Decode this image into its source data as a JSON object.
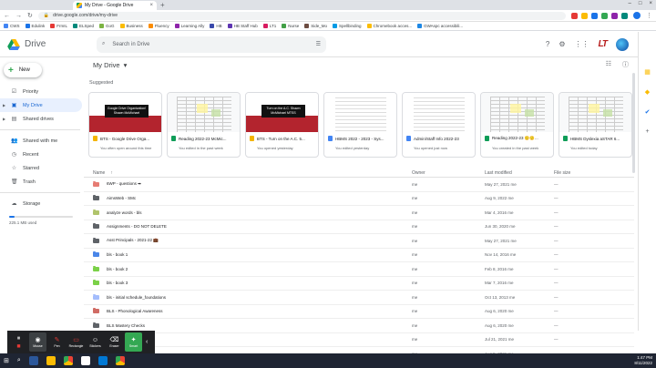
{
  "browser": {
    "tab_title": "My Drive - Google Drive",
    "url": "drive.google.com/drive/my-drive",
    "bookmarks": [
      "CWS",
      "Edulink",
      "FrmIL",
      "ELSped",
      "GoG",
      "Business",
      "Fluency",
      "Learning Ally",
      "HB",
      "HB Staff Hub",
      "LT1",
      "Nurse",
      "Side_Mo",
      "Spellbinding",
      "Chromebook acces...",
      "GWAspc accessibili..."
    ]
  },
  "drive": {
    "app_name": "Drive",
    "search_placeholder": "Search in Drive",
    "new_label": "New",
    "nav": [
      {
        "label": "Priority",
        "icon": "priority-icon"
      },
      {
        "label": "My Drive",
        "icon": "my-drive-icon"
      },
      {
        "label": "Shared drives",
        "icon": "shared-drives-icon"
      },
      {
        "label": "Shared with me",
        "icon": "shared-with-me-icon"
      },
      {
        "label": "Recent",
        "icon": "clock-icon"
      },
      {
        "label": "Starred",
        "icon": "star-icon"
      },
      {
        "label": "Trash",
        "icon": "trash-icon"
      },
      {
        "label": "Storage",
        "icon": "cloud-icon"
      }
    ],
    "storage_used": "225.1 MB used",
    "storage_fraction": 0.08,
    "breadcrumb": "My Drive",
    "suggested_label": "Suggested",
    "suggested": [
      {
        "title": "BTS - Google Drive Orga...",
        "sub": "You often open around this time",
        "kind": "slide",
        "thumb_text": "Google Drive Organization! Shawn McMichael",
        "color": "#f4b400"
      },
      {
        "title": "Reading 2022-23 McMic...",
        "sub": "You edited in the past week",
        "kind": "sheet",
        "color": "#0f9d58"
      },
      {
        "title": "BTS - Turn on the A.C. 5...",
        "sub": "You opened yesterday",
        "kind": "slide",
        "thumb_text": "Turn on the A.C. Shawn McMichael MTSS",
        "color": "#f4b400"
      },
      {
        "title": "HBMS 2022 - 2023 - Sys...",
        "sub": "You edited yesterday",
        "kind": "doc",
        "color": "#4285f4"
      },
      {
        "title": "Admin/Staff Info 2022-23",
        "sub": "You opened just now",
        "kind": "doc",
        "color": "#4285f4"
      },
      {
        "title": "Reading 2022-23 🙂🙂...",
        "sub": "You created in the past week",
        "kind": "sheet",
        "color": "#0f9d58"
      },
      {
        "title": "HBMS Dyslexia aSTAR 6...",
        "sub": "You edited today",
        "kind": "sheet",
        "color": "#0f9d58"
      }
    ],
    "columns": {
      "name": "Name",
      "owner": "Owner",
      "modified": "Last modified",
      "size": "File size"
    },
    "files": [
      {
        "name": "6WP - questions ➡",
        "owner": "me",
        "modified": "May 27, 2021 me",
        "size": "—",
        "color": "#e67c73"
      },
      {
        "name": "AimsWeb - SMc",
        "owner": "me",
        "modified": "Aug 9, 2022 me",
        "size": "—",
        "color": "#5f6368"
      },
      {
        "name": "analyze words - bls",
        "owner": "me",
        "modified": "Mar 4, 2016 me",
        "size": "—",
        "color": "#b0c46b"
      },
      {
        "name": "Assignments - DO NOT DELETE",
        "owner": "me",
        "modified": "Jun 30, 2020 me",
        "size": "—",
        "color": "#5f6368"
      },
      {
        "name": "Asst Principals - 2021-22 💼",
        "owner": "me",
        "modified": "May 27, 2021 me",
        "size": "—",
        "color": "#5f6368"
      },
      {
        "name": "bls - book 1",
        "owner": "me",
        "modified": "Nov 14, 2016 me",
        "size": "—",
        "color": "#4a86e8"
      },
      {
        "name": "bls - book 2",
        "owner": "me",
        "modified": "Feb 8, 2016 me",
        "size": "—",
        "color": "#7bd148"
      },
      {
        "name": "bls - book 3",
        "owner": "me",
        "modified": "Mar 7, 2016 me",
        "size": "—",
        "color": "#7bd148"
      },
      {
        "name": "bls - initial schedule_foundations",
        "owner": "me",
        "modified": "Oct 13, 2013 me",
        "size": "—",
        "color": "#a4bdfc"
      },
      {
        "name": "BLS - Phonological Awareness",
        "owner": "me",
        "modified": "Aug 6, 2020 me",
        "size": "—",
        "color": "#d06b64"
      },
      {
        "name": "BLS Mastery Checks",
        "owner": "me",
        "modified": "Aug 6, 2020 me",
        "size": "—",
        "color": "#5f6368"
      },
      {
        "name": "...",
        "owner": "me",
        "modified": "Jul 21, 2021 me",
        "size": "—",
        "color": "#5f6368"
      },
      {
        "name": "...LETE",
        "owner": "me",
        "modified": "Aug 5, 2021 me",
        "size": "—",
        "color": "#5f6368"
      }
    ]
  },
  "annotation_toolbar": {
    "buttons": [
      {
        "label": "Mouse",
        "icon": "mouse-icon"
      },
      {
        "label": "Pen",
        "icon": "pen-icon"
      },
      {
        "label": "Rectangle",
        "icon": "rectangle-icon"
      },
      {
        "label": "Stickers",
        "icon": "stickers-icon"
      },
      {
        "label": "Eraser",
        "icon": "eraser-icon"
      },
      {
        "label": "Smart",
        "icon": "smart-icon"
      }
    ]
  },
  "taskbar": {
    "time": "1:47 PM",
    "date": "8/11/2022"
  }
}
